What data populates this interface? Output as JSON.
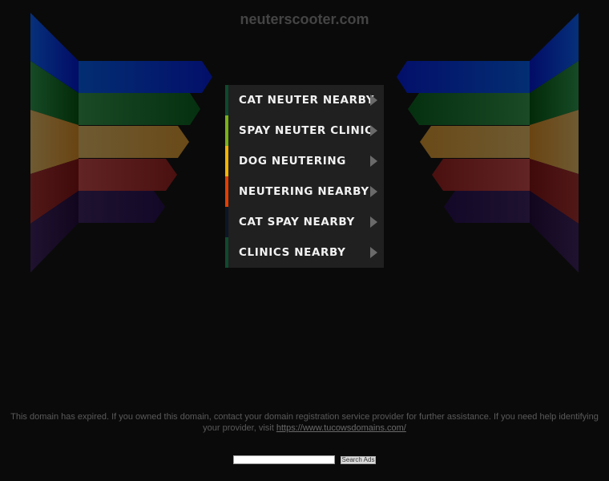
{
  "site": {
    "title": "neuterscooter.com"
  },
  "decoration": {
    "band_colors": [
      "#031a6e",
      "#0d3d18",
      "#7a5a24",
      "#5a1a1a",
      "#1a0c30"
    ]
  },
  "menu": {
    "items": [
      {
        "label": "CAT NEUTER NEARBY",
        "accent": "#0c4a2c",
        "icon": "arrow-right-icon"
      },
      {
        "label": "SPAY NEUTER CLINIC",
        "accent": "#7ab317",
        "icon": "arrow-right-icon"
      },
      {
        "label": "DOG NEUTERING",
        "accent": "#f5b400",
        "icon": "arrow-right-icon"
      },
      {
        "label": "NEUTERING NEARBY",
        "accent": "#e53d00",
        "icon": "arrow-right-icon"
      },
      {
        "label": "CAT SPAY NEARBY",
        "accent": "#0b1626",
        "icon": "arrow-right-icon"
      },
      {
        "label": "CLINICS NEARBY",
        "accent": "#0f4a2e",
        "icon": "arrow-right-icon"
      }
    ]
  },
  "footer": {
    "message_before": "This domain has expired. If you owned this domain, contact your domain registration service provider for further assistance. If you need help identifying your provider, visit ",
    "link_text": "https://www.tucowsdomains.com/"
  },
  "search": {
    "input_value": "",
    "button_label": "Search Ads"
  }
}
